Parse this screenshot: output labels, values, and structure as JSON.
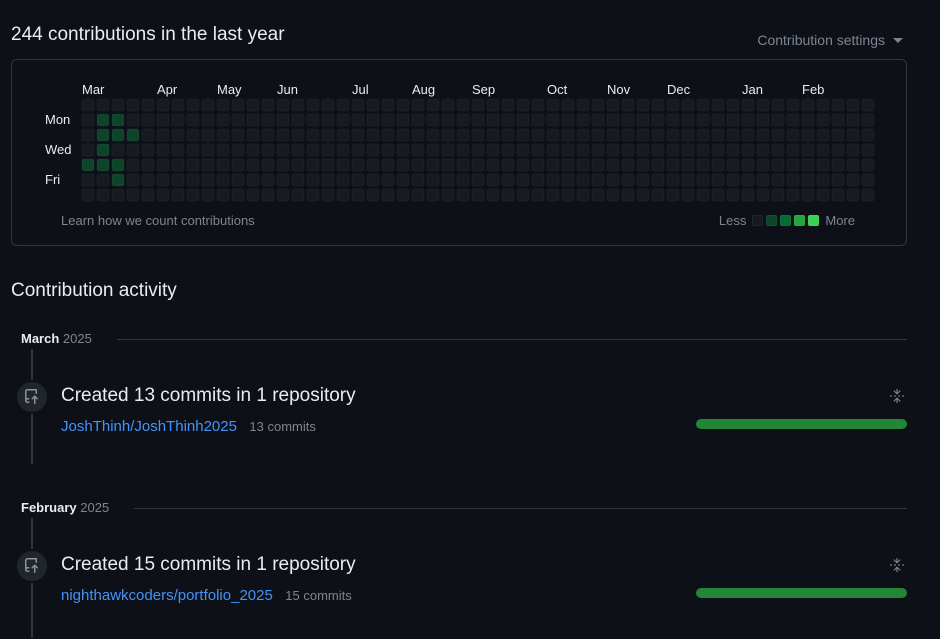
{
  "graph": {
    "title": "244 contributions in the last year",
    "settings_label": "Contribution settings",
    "months": [
      {
        "label": "Mar",
        "week": 0
      },
      {
        "label": "Apr",
        "week": 5
      },
      {
        "label": "May",
        "week": 9
      },
      {
        "label": "Jun",
        "week": 13
      },
      {
        "label": "Jul",
        "week": 18
      },
      {
        "label": "Aug",
        "week": 22
      },
      {
        "label": "Sep",
        "week": 26
      },
      {
        "label": "Oct",
        "week": 31
      },
      {
        "label": "Nov",
        "week": 35
      },
      {
        "label": "Dec",
        "week": 39
      },
      {
        "label": "Jan",
        "week": 44
      },
      {
        "label": "Feb",
        "week": 48
      }
    ],
    "day_labels": [
      {
        "label": "Mon",
        "row": 1
      },
      {
        "label": "Wed",
        "row": 3
      },
      {
        "label": "Fri",
        "row": 5
      }
    ],
    "levels": [
      "00000000000000000000000000000000000000000000000000000",
      "01100000000000000000000000000000000000000000000000000",
      "01110000000000000000000000000000000000000000000000000",
      "01000000000000000000000000000000000000000000000000000",
      "11100000000000000000000000000000000000000000000000000",
      "00100000000000000000000000000000000000000000000000000",
      "00000000000000000000000000000000000000000000000000000"
    ],
    "footer_text": "Learn how we count contributions",
    "legend_less": "Less",
    "legend_more": "More",
    "level_colors": [
      "#161b22",
      "#0e4429",
      "#006d32",
      "#26a641",
      "#39d353"
    ]
  },
  "activity": {
    "title": "Contribution activity",
    "months": [
      {
        "month": "March",
        "year": "2025",
        "event_title": "Created 13 commits in 1 repository",
        "repo": "JoshThinh/JoshThinh2025",
        "commits": "13 commits"
      },
      {
        "month": "February",
        "year": "2025",
        "event_title": "Created 15 commits in 1 repository",
        "repo": "nighthawkcoders/portfolio_2025",
        "commits": "15 commits"
      }
    ]
  }
}
